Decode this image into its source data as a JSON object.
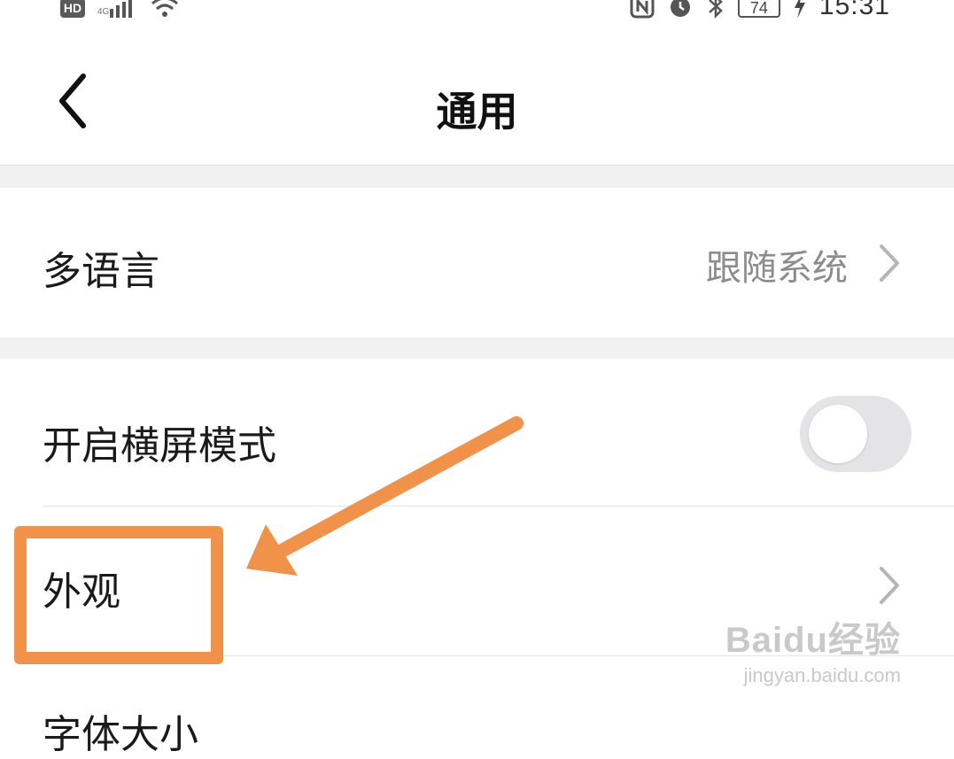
{
  "status_bar": {
    "hd_badge": "HD",
    "battery": "74",
    "time": "15:31"
  },
  "header": {
    "title": "通用"
  },
  "settings": {
    "language": {
      "label": "多语言",
      "value": "跟随系统"
    },
    "landscape": {
      "label": "开启横屏模式",
      "enabled": false
    },
    "appearance": {
      "label": "外观"
    },
    "next_item": {
      "label": "字体大小"
    }
  },
  "annotation": {
    "color": "#f0924a"
  },
  "watermark": {
    "logo": "Baidu经验",
    "url": "jingyan.baidu.com"
  },
  "icons": [
    "signal-icon",
    "wifi-icon",
    "nfc-icon",
    "alarm-icon",
    "bluetooth-icon",
    "charging-icon",
    "back-icon",
    "chevron-right-icon"
  ]
}
